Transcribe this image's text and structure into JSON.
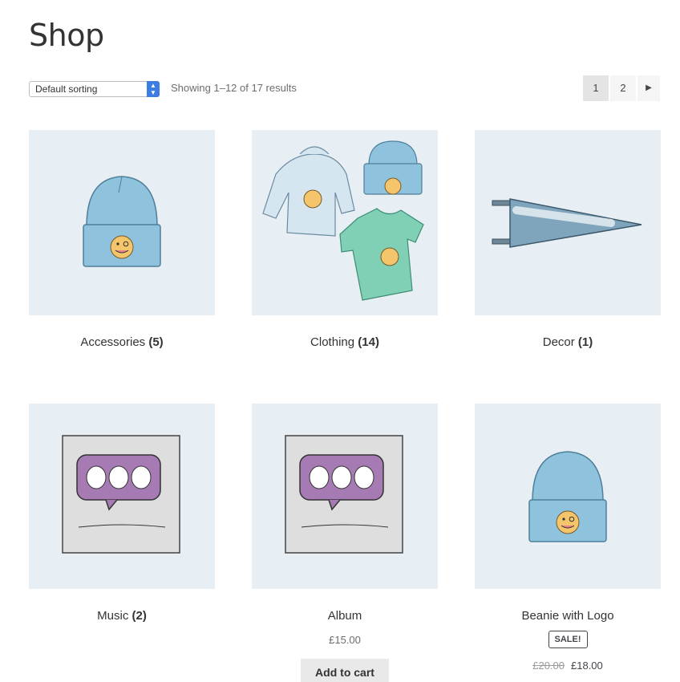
{
  "page": {
    "title": "Shop"
  },
  "toolbar": {
    "sort_value": "Default sorting",
    "result_count": "Showing 1–12 of 17 results"
  },
  "pagination": {
    "pages": [
      "1",
      "2"
    ],
    "current": "1",
    "next_icon": "arrow-right-icon"
  },
  "categories": [
    {
      "name": "Accessories",
      "count": "(5)"
    },
    {
      "name": "Clothing",
      "count": "(14)"
    },
    {
      "name": "Decor",
      "count": "(1)"
    },
    {
      "name": "Music",
      "count": "(2)"
    }
  ],
  "products": [
    {
      "name": "Album",
      "price": "£15.00",
      "button": "Add to cart"
    },
    {
      "name": "Beanie with Logo",
      "badge": "SALE!",
      "regular_price": "£20.00",
      "sale_price": "£18.00"
    }
  ],
  "colors": {
    "thumb_bg": "#e7eef4",
    "select_accent": "#3b7de0"
  }
}
